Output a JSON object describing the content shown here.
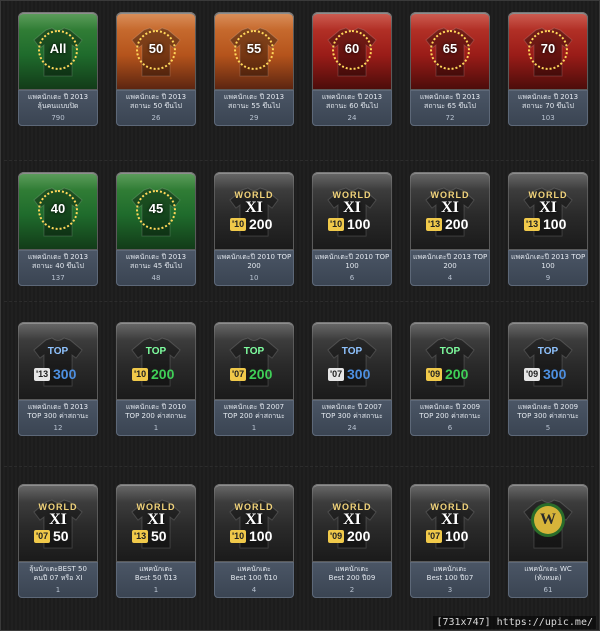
{
  "cards": [
    {
      "name": "แพคนักเตะ ปี 2013",
      "sub": "ลุ้นคนแบบปิด",
      "count": "790",
      "label": "All",
      "theme": "green"
    },
    {
      "name": "แพคนักเตะ ปี 2013",
      "sub": "สถานะ 50 ขึ้นไป",
      "count": "26",
      "label": "50",
      "theme": "orange"
    },
    {
      "name": "แพคนักเตะ ปี 2013",
      "sub": "สถานะ 55 ขึ้นไป",
      "count": "29",
      "label": "55",
      "theme": "orange"
    },
    {
      "name": "แพคนักเตะ ปี 2013",
      "sub": "สถานะ 60 ขึ้นไป",
      "count": "24",
      "label": "60",
      "theme": "red"
    },
    {
      "name": "แพคนักเตะ ปี 2013",
      "sub": "สถานะ 65 ขึ้นไป",
      "count": "72",
      "label": "65",
      "theme": "red"
    },
    {
      "name": "แพคนักเตะ ปี 2013",
      "sub": "สถานะ 70 ขึ้นไป",
      "count": "103",
      "label": "70",
      "theme": "red"
    },
    {
      "name": "แพคนักเตะ ปี 2013",
      "sub": "สถานะ 40 ขึ้นไป",
      "count": "137",
      "label": "40",
      "theme": "green"
    },
    {
      "name": "แพคนักเตะ ปี 2013",
      "sub": "สถานะ 45 ขึ้นไป",
      "count": "48",
      "label": "45",
      "theme": "green"
    },
    {
      "name": "แพคนักเตะปี 2010 TOP",
      "sub": "200",
      "count": "10",
      "label": "200",
      "tag": "10",
      "theme": "worldxi"
    },
    {
      "name": "แพคนักเตะปี 2010 TOP",
      "sub": "100",
      "count": "6",
      "label": "100",
      "tag": "10",
      "theme": "worldxi"
    },
    {
      "name": "แพคนักเตะปี 2013 TOP",
      "sub": "200",
      "count": "4",
      "label": "200",
      "tag": "13",
      "theme": "worldxi"
    },
    {
      "name": "แพคนักเตะปี 2013 TOP",
      "sub": "100",
      "count": "9",
      "label": "100",
      "tag": "13",
      "theme": "worldxi"
    },
    {
      "name": "แพคนักเตะ ปี 2013",
      "sub": "TOP 300 ค่าสถานะ",
      "count": "12",
      "label": "300",
      "tag": "13",
      "theme": "top-blue"
    },
    {
      "name": "แพคนักเตะ ปี 2010",
      "sub": "TOP 200 ค่าสถานะ",
      "count": "1",
      "label": "200",
      "tag": "10",
      "theme": "top-green"
    },
    {
      "name": "แพคนักเตะ ปี 2007",
      "sub": "TOP 200 ค่าสถานะ",
      "count": "1",
      "label": "200",
      "tag": "07",
      "theme": "top-green"
    },
    {
      "name": "แพคนักเตะ ปี 2007",
      "sub": "TOP 300 ค่าสถานะ",
      "count": "24",
      "label": "300",
      "tag": "07",
      "theme": "top-blue"
    },
    {
      "name": "แพคนักเตะ ปี 2009",
      "sub": "TOP 200 ค่าสถานะ",
      "count": "6",
      "label": "200",
      "tag": "09",
      "theme": "top-green"
    },
    {
      "name": "แพคนักเตะ ปี 2009",
      "sub": "TOP 300 ค่าสถานะ",
      "count": "5",
      "label": "300",
      "tag": "09",
      "theme": "top-blue"
    },
    {
      "name": "ลุ้นนักเตะBEST 50",
      "sub": "คนปี 07 หรือ XI",
      "count": "1",
      "label": "50",
      "tag": "07",
      "theme": "worldxi"
    },
    {
      "name": "แพคนักเตะ",
      "sub": "Best 50 ปี13",
      "count": "1",
      "label": "50",
      "tag": "13",
      "theme": "worldxi"
    },
    {
      "name": "แพคนักเตะ",
      "sub": "Best 100 ปี10",
      "count": "4",
      "label": "100",
      "tag": "10",
      "theme": "worldxi"
    },
    {
      "name": "แพคนักเตะ",
      "sub": "Best 200 ปี09",
      "count": "2",
      "label": "200",
      "tag": "09",
      "theme": "worldxi"
    },
    {
      "name": "แพคนักเตะ",
      "sub": "Best 100 ปี07",
      "count": "3",
      "label": "100",
      "tag": "07",
      "theme": "worldxi"
    },
    {
      "name": "แพคนักเตะ WC",
      "sub": "(ทั้งหมด)",
      "count": "61",
      "label": "W",
      "theme": "wc"
    }
  ],
  "watermark": "[731x747] https://upic.me/",
  "colors": {
    "green": "#1f6b2c",
    "orange": "#b5541c",
    "red": "#9a1c18",
    "gold": "#ffd75a",
    "blueNum": "#4d8fe0",
    "greenNum": "#3fcf57"
  },
  "icons": {
    "ring": "star-ring-icon",
    "world": "world-xi-crest-icon",
    "top": "top-crest-icon",
    "wc": "world-cup-w-icon"
  }
}
